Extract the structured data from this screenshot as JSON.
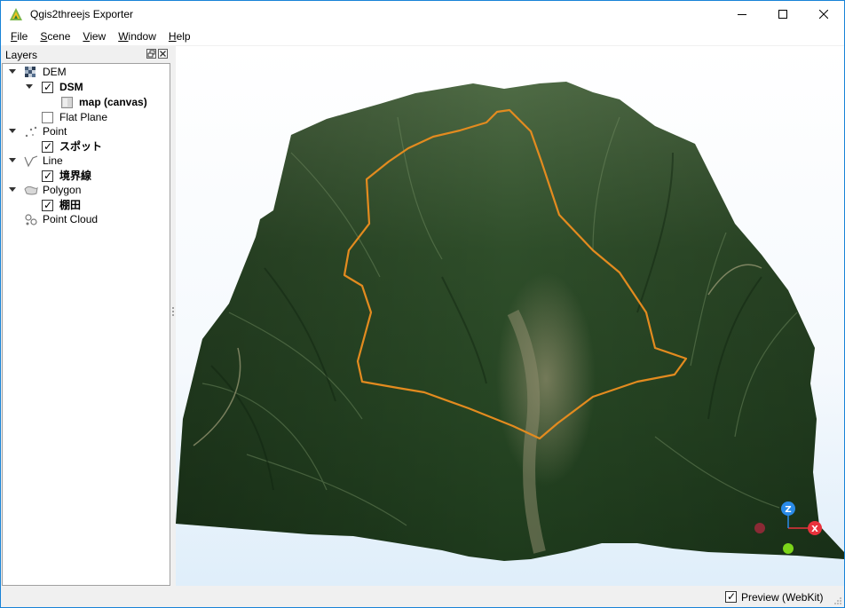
{
  "window": {
    "title": "Qgis2threejs Exporter",
    "buttons": {
      "minimize": "minimize-icon",
      "maximize": "maximize-icon",
      "close": "close-icon"
    }
  },
  "menu": [
    {
      "label": "File",
      "mnemonic": "F",
      "rest": "ile"
    },
    {
      "label": "Scene",
      "mnemonic": "S",
      "rest": "cene"
    },
    {
      "label": "View",
      "mnemonic": "V",
      "rest": "iew"
    },
    {
      "label": "Window",
      "mnemonic": "W",
      "rest": "indow"
    },
    {
      "label": "Help",
      "mnemonic": "H",
      "rest": "elp"
    }
  ],
  "layers_panel": {
    "title": "Layers",
    "groups": {
      "dem": {
        "label": "DEM",
        "icon": "dem-icon",
        "items": {
          "dsm": {
            "label": "DSM",
            "checked": true,
            "children": {
              "map": {
                "label": "map (canvas)",
                "icon": "map-canvas-icon"
              }
            }
          },
          "flat_plane": {
            "label": "Flat Plane",
            "checked": false
          }
        }
      },
      "point": {
        "label": "Point",
        "icon": "point-icon",
        "items": {
          "spot": {
            "label": "スポット",
            "checked": true
          }
        }
      },
      "line": {
        "label": "Line",
        "icon": "line-icon",
        "items": {
          "boundary": {
            "label": "境界線",
            "checked": true
          }
        }
      },
      "polygon": {
        "label": "Polygon",
        "icon": "polygon-icon",
        "items": {
          "rice_terrace": {
            "label": "棚田",
            "checked": true
          }
        }
      },
      "point_cloud": {
        "label": "Point Cloud",
        "icon": "point-cloud-icon"
      }
    }
  },
  "preview": {
    "axes": {
      "z": "Z",
      "x": "X"
    },
    "colors": {
      "boundary_line": "#e38b1f",
      "terrain_dark": "#1f3a1c",
      "terrain_light": "#6b8a5c",
      "axis_x": "#e8323c",
      "axis_y": "#7cd41a",
      "axis_z": "#2a8be8"
    }
  },
  "statusbar": {
    "preview_label": "Preview (WebKit)",
    "preview_checked": true
  },
  "colors": {
    "accent": "#1883d7"
  }
}
